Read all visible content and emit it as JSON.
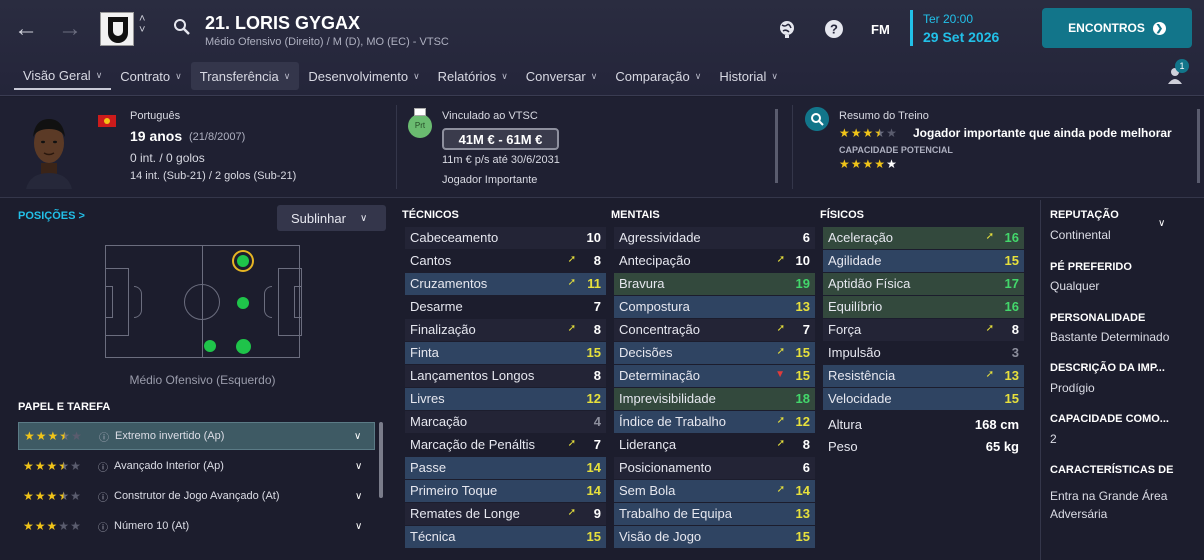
{
  "header": {
    "player_name": "21. LORIS GYGAX",
    "player_position": "Médio Ofensivo (Direito) / M (D), MO (EC) - VTSC",
    "fm_label": "FM",
    "time": "Ter 20:00",
    "date": "29 Set 2026",
    "continue_label": "ENCONTROS",
    "notifications": "1",
    "icons": [
      "back-arrow",
      "forward-arrow",
      "club-badge",
      "search-icon",
      "globe-icon",
      "help-icon",
      "fm-menu",
      "continue-arrow-icon",
      "notification-icon"
    ]
  },
  "tabs": [
    {
      "label": "Visão Geral"
    },
    {
      "label": "Contrato"
    },
    {
      "label": "Transferência"
    },
    {
      "label": "Desenvolvimento"
    },
    {
      "label": "Relatórios"
    },
    {
      "label": "Conversar"
    },
    {
      "label": "Comparação"
    },
    {
      "label": "Historial"
    }
  ],
  "profile": {
    "nationality": "Português",
    "age": "19 anos",
    "dob": "(21/8/2007)",
    "caps": "0 int. / 0 golos",
    "youth_caps": "14 int. (Sub-21) / 2 golos (Sub-21)",
    "club_short": "Prt",
    "contract_club": "Vinculado ao VTSC",
    "value_range": "41M € - 61M €",
    "wage": "11m € p/s até 30/6/2031",
    "squad_status": "Jogador Importante",
    "training_title": "Resumo do Treino",
    "current_ability_stars": 3.5,
    "training_summary": "Jogador importante que ainda pode melhorar",
    "potential_label": "CAPACIDADE POTENCIAL",
    "potential_stars": 4.5
  },
  "positions": {
    "title": "POSIÇÕES",
    "title_chevron": ">",
    "highlight_label": "Sublinhar",
    "selected_position": "Médio Ofensivo (Esquerdo)"
  },
  "roles": {
    "title": "PAPEL E TAREFA",
    "items": [
      {
        "stars": 3.5,
        "name": "Extremo invertido (Ap)"
      },
      {
        "stars": 3.5,
        "name": "Avançado Interior (Ap)"
      },
      {
        "stars": 3.5,
        "name": "Construtor de Jogo Avançado (At)"
      },
      {
        "stars": 3.0,
        "name": "Número 10 (At)"
      }
    ]
  },
  "tecnicos": {
    "title": "TÉCNICOS",
    "items": [
      {
        "name": "Cabeceamento",
        "value": "10",
        "trend": ""
      },
      {
        "name": "Cantos",
        "value": "8",
        "trend": "up"
      },
      {
        "name": "Cruzamentos",
        "value": "11",
        "trend": "up"
      },
      {
        "name": "Desarme",
        "value": "7",
        "trend": ""
      },
      {
        "name": "Finalização",
        "value": "8",
        "trend": "up"
      },
      {
        "name": "Finta",
        "value": "15",
        "trend": ""
      },
      {
        "name": "Lançamentos Longos",
        "value": "8",
        "trend": ""
      },
      {
        "name": "Livres",
        "value": "12",
        "trend": ""
      },
      {
        "name": "Marcação",
        "value": "4",
        "trend": ""
      },
      {
        "name": "Marcação de Penáltis",
        "value": "7",
        "trend": "up"
      },
      {
        "name": "Passe",
        "value": "14",
        "trend": ""
      },
      {
        "name": "Primeiro Toque",
        "value": "14",
        "trend": ""
      },
      {
        "name": "Remates de Longe",
        "value": "9",
        "trend": "up"
      },
      {
        "name": "Técnica",
        "value": "15",
        "trend": ""
      }
    ]
  },
  "mentais": {
    "title": "MENTAIS",
    "items": [
      {
        "name": "Agressividade",
        "value": "6",
        "trend": ""
      },
      {
        "name": "Antecipação",
        "value": "10",
        "trend": "up"
      },
      {
        "name": "Bravura",
        "value": "19",
        "trend": ""
      },
      {
        "name": "Compostura",
        "value": "13",
        "trend": ""
      },
      {
        "name": "Concentração",
        "value": "7",
        "trend": "up"
      },
      {
        "name": "Decisões",
        "value": "15",
        "trend": "up"
      },
      {
        "name": "Determinação",
        "value": "15",
        "trend": "down"
      },
      {
        "name": "Imprevisibilidade",
        "value": "18",
        "trend": ""
      },
      {
        "name": "Índice de Trabalho",
        "value": "12",
        "trend": "up"
      },
      {
        "name": "Liderança",
        "value": "8",
        "trend": "up"
      },
      {
        "name": "Posicionamento",
        "value": "6",
        "trend": ""
      },
      {
        "name": "Sem Bola",
        "value": "14",
        "trend": "up"
      },
      {
        "name": "Trabalho de Equipa",
        "value": "13",
        "trend": ""
      },
      {
        "name": "Visão de Jogo",
        "value": "15",
        "trend": ""
      }
    ]
  },
  "fisicos": {
    "title": "FÍSICOS",
    "items": [
      {
        "name": "Aceleração",
        "value": "16",
        "trend": "up"
      },
      {
        "name": "Agilidade",
        "value": "15",
        "trend": ""
      },
      {
        "name": "Aptidão Física",
        "value": "17",
        "trend": ""
      },
      {
        "name": "Equilíbrio",
        "value": "16",
        "trend": ""
      },
      {
        "name": "Força",
        "value": "8",
        "trend": "up"
      },
      {
        "name": "Impulsão",
        "value": "3",
        "trend": ""
      },
      {
        "name": "Resistência",
        "value": "13",
        "trend": "up"
      },
      {
        "name": "Velocidade",
        "value": "15",
        "trend": ""
      }
    ],
    "height_label": "Altura",
    "height": "168 cm",
    "weight_label": "Peso",
    "weight": "65 kg"
  },
  "info": {
    "reputation_label": "REPUTAÇÃO",
    "reputation": "Continental",
    "foot_label": "PÉ PREFERIDO",
    "foot": "Qualquer",
    "personality_label": "PERSONALIDADE",
    "personality": "Bastante Determinado",
    "media_label": "DESCRIÇÃO DA IMP...",
    "media": "Prodígio",
    "ability_label": "CAPACIDADE COMO...",
    "ability": "2",
    "traits_label": "CARACTERÍSTICAS DE",
    "traits": "Entra na Grande Área Adversária"
  },
  "colors": {
    "accent": "#22c0e8",
    "button": "#12758a",
    "star": "#f0c419",
    "value_green": "#43d76b",
    "value_yellow": "#e7e03c",
    "row_green": "#33493d",
    "row_blue": "#2f4462"
  }
}
